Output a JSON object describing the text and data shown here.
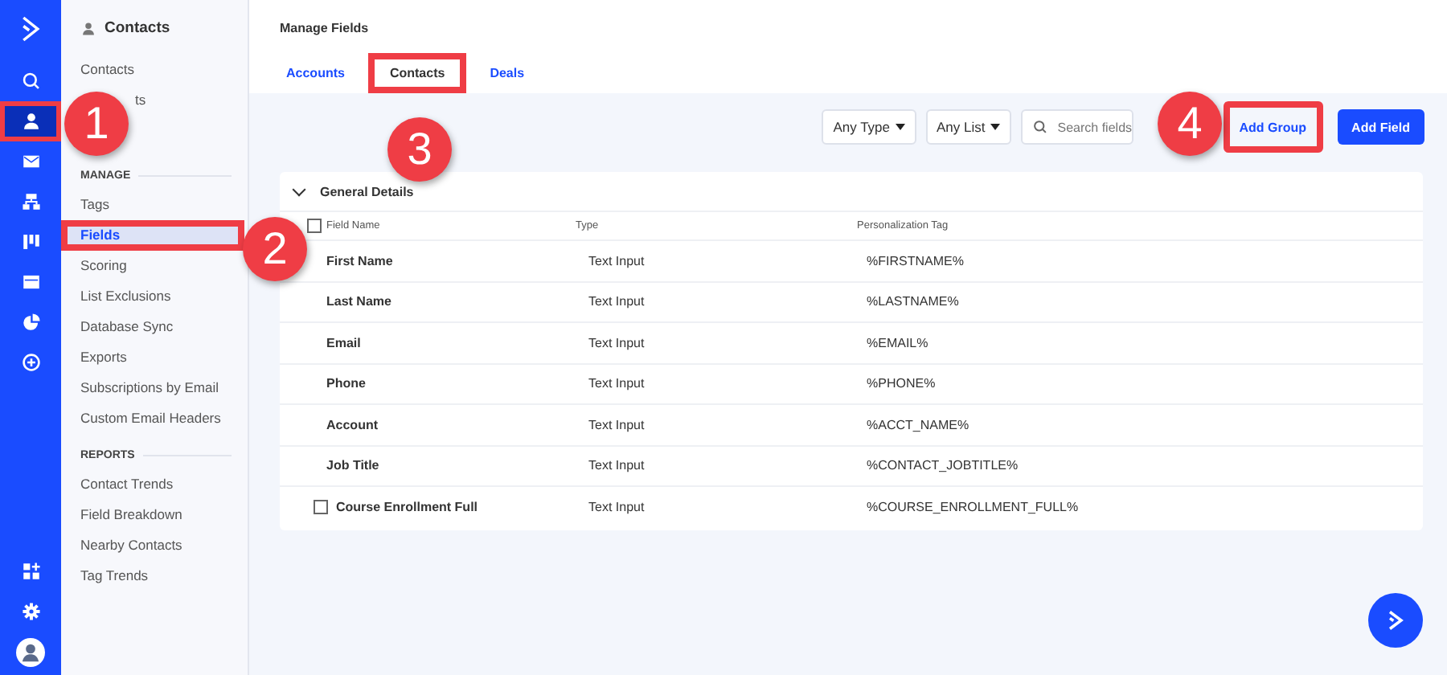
{
  "rail": {
    "top": [
      {
        "kind": "search",
        "selected": false,
        "highlighted": false
      },
      {
        "kind": "person",
        "selected": true,
        "highlighted": true
      },
      {
        "kind": "mail",
        "selected": false,
        "highlighted": false
      },
      {
        "kind": "org",
        "selected": false,
        "highlighted": false
      },
      {
        "kind": "board",
        "selected": false,
        "highlighted": false
      },
      {
        "kind": "window",
        "selected": false,
        "highlighted": false
      },
      {
        "kind": "pie",
        "selected": false,
        "highlighted": false
      },
      {
        "kind": "plus",
        "selected": false,
        "highlighted": false
      }
    ],
    "bottom": [
      {
        "kind": "apps",
        "selected": false,
        "highlighted": false
      },
      {
        "kind": "gear",
        "selected": false,
        "highlighted": false
      },
      {
        "kind": "avatar",
        "selected": false,
        "highlighted": false
      }
    ]
  },
  "sidebar": {
    "title": "Contacts",
    "sections": [
      {
        "items": [
          {
            "label": "Contacts",
            "selected": false,
            "highlighted": false
          },
          {
            "label": "ts",
            "selected": false,
            "highlighted": false
          }
        ]
      },
      {
        "heading": "MANAGE",
        "items": [
          {
            "label": "Tags",
            "selected": false,
            "highlighted": false
          },
          {
            "label": "Fields",
            "selected": true,
            "highlighted": true
          },
          {
            "label": "Scoring",
            "selected": false,
            "highlighted": false
          },
          {
            "label": "List Exclusions",
            "selected": false,
            "highlighted": false
          },
          {
            "label": "Database Sync",
            "selected": false,
            "highlighted": false
          },
          {
            "label": "Exports",
            "selected": false,
            "highlighted": false
          },
          {
            "label": "Subscriptions by Email",
            "selected": false,
            "highlighted": false
          },
          {
            "label": "Custom Email Headers",
            "selected": false,
            "highlighted": false
          }
        ]
      },
      {
        "heading": "REPORTS",
        "items": [
          {
            "label": "Contact Trends",
            "selected": false,
            "highlighted": false
          },
          {
            "label": "Field Breakdown",
            "selected": false,
            "highlighted": false
          },
          {
            "label": "Nearby Contacts",
            "selected": false,
            "highlighted": false
          },
          {
            "label": "Tag Trends",
            "selected": false,
            "highlighted": false
          }
        ]
      }
    ]
  },
  "header": {
    "title": "Manage Fields"
  },
  "tabs": [
    {
      "label": "Accounts",
      "selected": false,
      "highlighted": false
    },
    {
      "label": "Contacts",
      "selected": true,
      "highlighted": true
    },
    {
      "label": "Deals",
      "selected": false,
      "highlighted": false
    }
  ],
  "toolbar": {
    "filters": [
      "Any Type",
      "Any List"
    ],
    "search": {
      "placeholder": "Search fields"
    },
    "buttons": [
      {
        "label": "Add Group",
        "kind": "secondary",
        "highlighted": true
      },
      {
        "label": "Add Field",
        "kind": "primary",
        "highlighted": false
      }
    ]
  },
  "group": {
    "title": "General Details",
    "expanded": true,
    "columns": [
      {
        "label": "Field Name",
        "kind": "checkbox",
        "checked": false
      },
      {
        "label": "Type",
        "kind": "text"
      },
      {
        "label": "Personalization Tag",
        "kind": "text"
      }
    ],
    "rows": [
      {
        "name": "First Name",
        "type": "Text Input",
        "tag": "%FIRSTNAME%",
        "kind": "plain"
      },
      {
        "name": "Last Name",
        "type": "Text Input",
        "tag": "%LASTNAME%",
        "kind": "plain"
      },
      {
        "name": "Email",
        "type": "Text Input",
        "tag": "%EMAIL%",
        "kind": "plain"
      },
      {
        "name": "Phone",
        "type": "Text Input",
        "tag": "%PHONE%",
        "kind": "plain"
      },
      {
        "name": "Account",
        "type": "Text Input",
        "tag": "%ACCT_NAME%",
        "kind": "plain"
      },
      {
        "name": "Job Title",
        "type": "Text Input",
        "tag": "%CONTACT_JOBTITLE%",
        "kind": "plain"
      },
      {
        "name": "Course Enrollment Full",
        "type": "Text Input",
        "tag": "%COURSE_ENROLLMENT_FULL%",
        "kind": "checkbox",
        "checked": false
      }
    ]
  },
  "annotations": [
    {
      "number": "1"
    },
    {
      "number": "2"
    },
    {
      "number": "3"
    },
    {
      "number": "4"
    }
  ]
}
